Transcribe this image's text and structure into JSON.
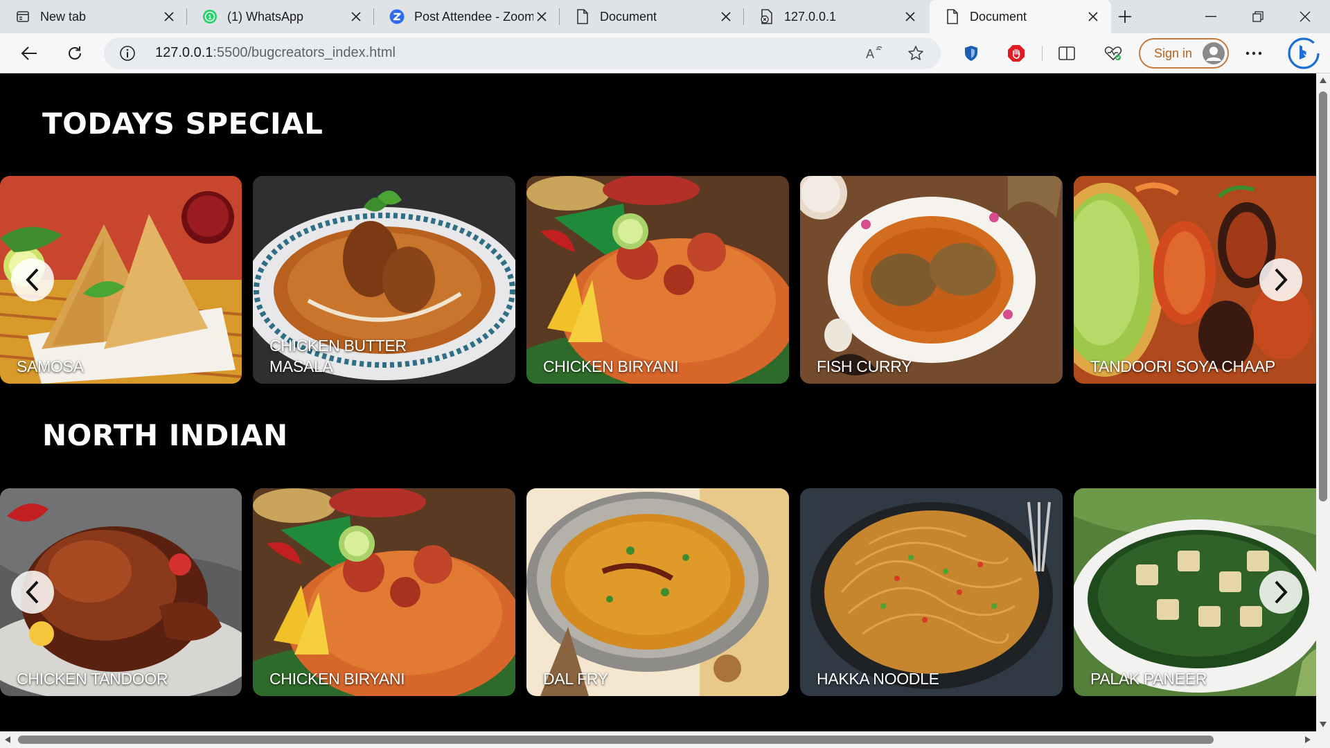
{
  "browser": {
    "tabs": [
      {
        "title": "New tab",
        "icon": "new-tab-icon"
      },
      {
        "title": "(1) WhatsApp",
        "icon": "whatsapp-icon"
      },
      {
        "title": "Post Attendee - Zoom",
        "icon": "zoom-icon"
      },
      {
        "title": "Document",
        "icon": "document-icon"
      },
      {
        "title": "127.0.0.1",
        "icon": "file-error-icon"
      },
      {
        "title": "Document",
        "icon": "document-icon"
      }
    ],
    "active_tab": 5,
    "url_host": "127.0.0.1",
    "url_path": ":5500/bugcreators_index.html",
    "sign_in_label": "Sign in",
    "accent_color": "#c5793d"
  },
  "sections": [
    {
      "title": "TODAYS SPECIAL",
      "items": [
        {
          "name": "SAMOSA"
        },
        {
          "name": "CHICKEN BUTTER MASALA",
          "line1": "CHICKEN BUTTER",
          "line2": "MASALA"
        },
        {
          "name": "CHICKEN BIRYANI"
        },
        {
          "name": "FISH CURRY"
        },
        {
          "name": "TANDOORI SOYA CHAAP"
        }
      ]
    },
    {
      "title": "NORTH INDIAN",
      "items": [
        {
          "name": "CHICKEN TANDOOR"
        },
        {
          "name": "CHICKEN BIRYANI"
        },
        {
          "name": "DAL FRY"
        },
        {
          "name": "HAKKA NOODLE"
        },
        {
          "name": "PALAK PANEER"
        }
      ]
    }
  ]
}
